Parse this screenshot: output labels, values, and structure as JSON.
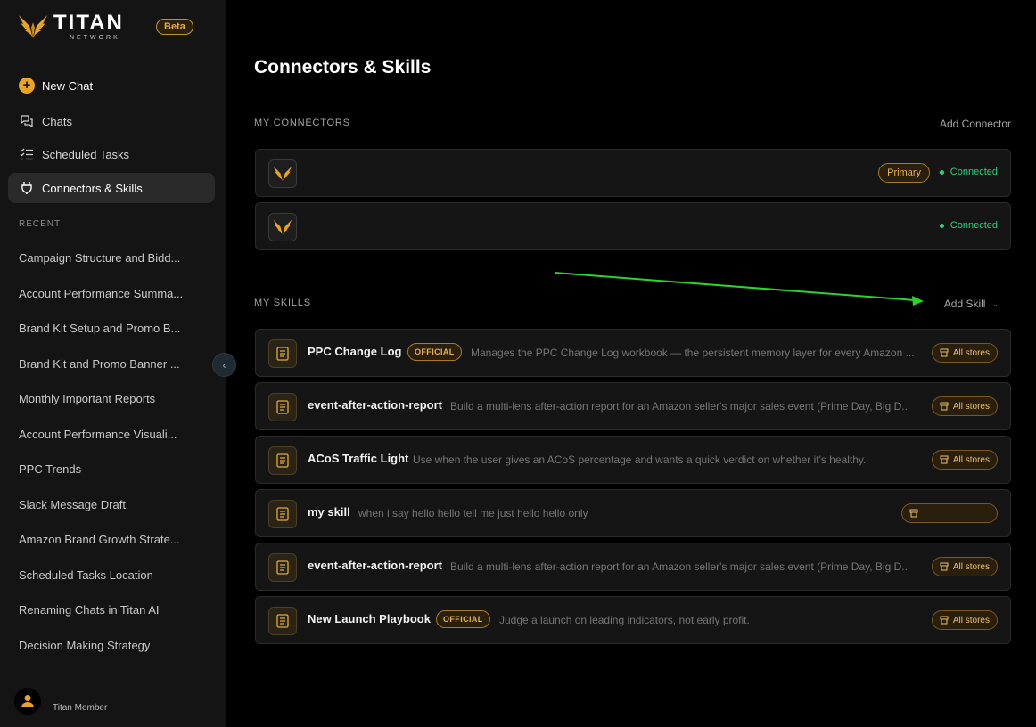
{
  "brand": {
    "title": "TITAN",
    "subtitle": "NETWORK",
    "beta": "Beta",
    "accent": "#e9a521"
  },
  "sidebar": {
    "nav": [
      {
        "label": "New Chat",
        "icon": "plus-circle-icon"
      },
      {
        "label": "Chats",
        "icon": "chat-bubbles-icon"
      },
      {
        "label": "Scheduled Tasks",
        "icon": "checklist-icon"
      },
      {
        "label": "Connectors & Skills",
        "icon": "plug-icon"
      }
    ],
    "recent_label": "RECENT",
    "recent": [
      "Campaign Structure and Bidd...",
      "Account Performance Summa...",
      "Brand Kit Setup and Promo B...",
      "Brand Kit and Promo Banner ...",
      "Monthly Important Reports",
      "Account Performance Visuali...",
      "PPC Trends",
      "Slack Message Draft",
      "Amazon Brand Growth Strate...",
      "Scheduled Tasks Location",
      "Renaming Chats in Titan AI",
      "Decision Making Strategy"
    ],
    "user": {
      "name": "Titan Member"
    }
  },
  "main": {
    "title": "Connectors & Skills",
    "connectors": {
      "label": "MY CONNECTORS",
      "add": "Add Connector",
      "items": [
        {
          "badge": "Primary",
          "status": "Connected"
        },
        {
          "badge": "",
          "status": "Connected"
        }
      ]
    },
    "skills": {
      "label": "MY SKILLS",
      "add": "Add Skill",
      "items": [
        {
          "name": "PPC Change Log",
          "official": "OFFICIAL",
          "desc": "Manages the PPC Change Log workbook — the persistent memory layer for every Amazon ...",
          "stores": "All stores"
        },
        {
          "name": "event-after-action-report",
          "official": "",
          "desc": "Build a multi-lens after-action report for an Amazon seller's major sales event (Prime Day, Big D...",
          "stores": "All stores"
        },
        {
          "name": "ACoS Traffic Light",
          "official": "",
          "desc": "Use when the user gives an ACoS percentage and wants a quick verdict on whether it's healthy.",
          "stores": "All stores"
        },
        {
          "name": "my skill",
          "official": "",
          "desc": "when i say hello hello tell me just hello hello only",
          "stores": ""
        },
        {
          "name": "event-after-action-report",
          "official": "",
          "desc": "Build a multi-lens after-action report for an Amazon seller's major sales event (Prime Day, Big D...",
          "stores": "All stores"
        },
        {
          "name": "New Launch Playbook",
          "official": "OFFICIAL",
          "desc": "Judge a launch on leading indicators, not early profit.",
          "stores": "All stores"
        }
      ]
    },
    "status_color": "#2ecf7c",
    "annotation_arrow_color": "#2bd62b"
  }
}
